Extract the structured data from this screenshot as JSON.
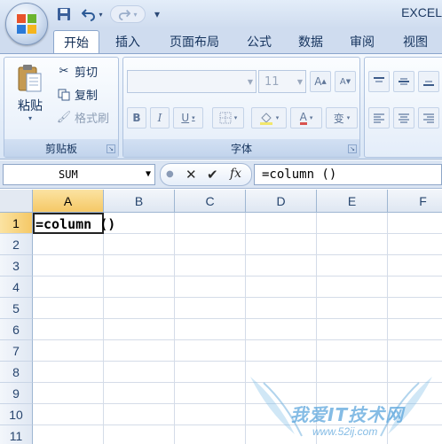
{
  "app": {
    "title": "EXCEL"
  },
  "quick_access": {
    "save_icon": "save-icon",
    "undo_icon": "undo-icon",
    "redo_icon": "redo-icon",
    "customize_glyph": "▾"
  },
  "tabs": [
    {
      "label": "开始",
      "active": true
    },
    {
      "label": "插入",
      "active": false
    },
    {
      "label": "页面布局",
      "active": false
    },
    {
      "label": "公式",
      "active": false
    },
    {
      "label": "数据",
      "active": false
    },
    {
      "label": "审阅",
      "active": false
    },
    {
      "label": "视图",
      "active": false
    }
  ],
  "clipboard": {
    "label": "剪贴板",
    "paste": "粘贴",
    "cut": "剪切",
    "copy": "复制",
    "format_painter": "格式刷"
  },
  "font": {
    "label": "字体",
    "family": "",
    "size": "11",
    "grow_glyph": "A",
    "shrink_glyph": "A",
    "bold": "B",
    "italic": "I",
    "underline": "U",
    "font_color_glyph": "A",
    "phonetic_glyph": "变"
  },
  "formula_bar": {
    "name_box": "SUM",
    "fx_label": "fx",
    "formula": "=column ()"
  },
  "columns": [
    "A",
    "B",
    "C",
    "D",
    "E",
    "F"
  ],
  "rows": [
    "1",
    "2",
    "3",
    "4",
    "5",
    "6",
    "7",
    "8",
    "9",
    "10",
    "11"
  ],
  "cells": {
    "A1": "=column ()"
  },
  "selection": {
    "column": "A",
    "row": "1"
  },
  "watermark": {
    "text": "我爱IT技术网",
    "url": "www.52ij.com"
  },
  "colors": {
    "accent": "#cfdcef",
    "selected_header": "#f5c866",
    "gridline": "#d4dce8"
  }
}
